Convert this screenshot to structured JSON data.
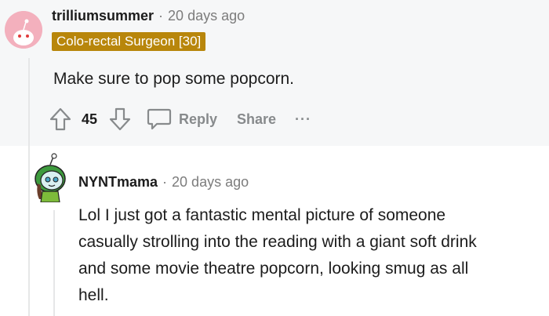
{
  "comment1": {
    "username": "trilliumsummer",
    "separator": "·",
    "timestamp": "20 days ago",
    "flair": "Colo-rectal Surgeon [30]",
    "body": "Make sure to pop some popcorn.",
    "score": "45",
    "reply_label": "Reply",
    "share_label": "Share",
    "more_label": "···"
  },
  "comment2": {
    "username": "NYNTmama",
    "separator": "·",
    "timestamp": "20 days ago",
    "body_lines": [
      "Lol I just got a fantastic mental picture of someone",
      "casually strolling into the reading with a giant soft drink",
      "and some movie theatre popcorn, looking smug as all",
      "hell."
    ]
  },
  "colors": {
    "highlight_bg": "#f6f7f8",
    "flair_bg": "#b8860b",
    "muted_text": "#7c7c7c",
    "action_gray": "#878a8c",
    "avatar1_bg": "#f3b0bd"
  }
}
